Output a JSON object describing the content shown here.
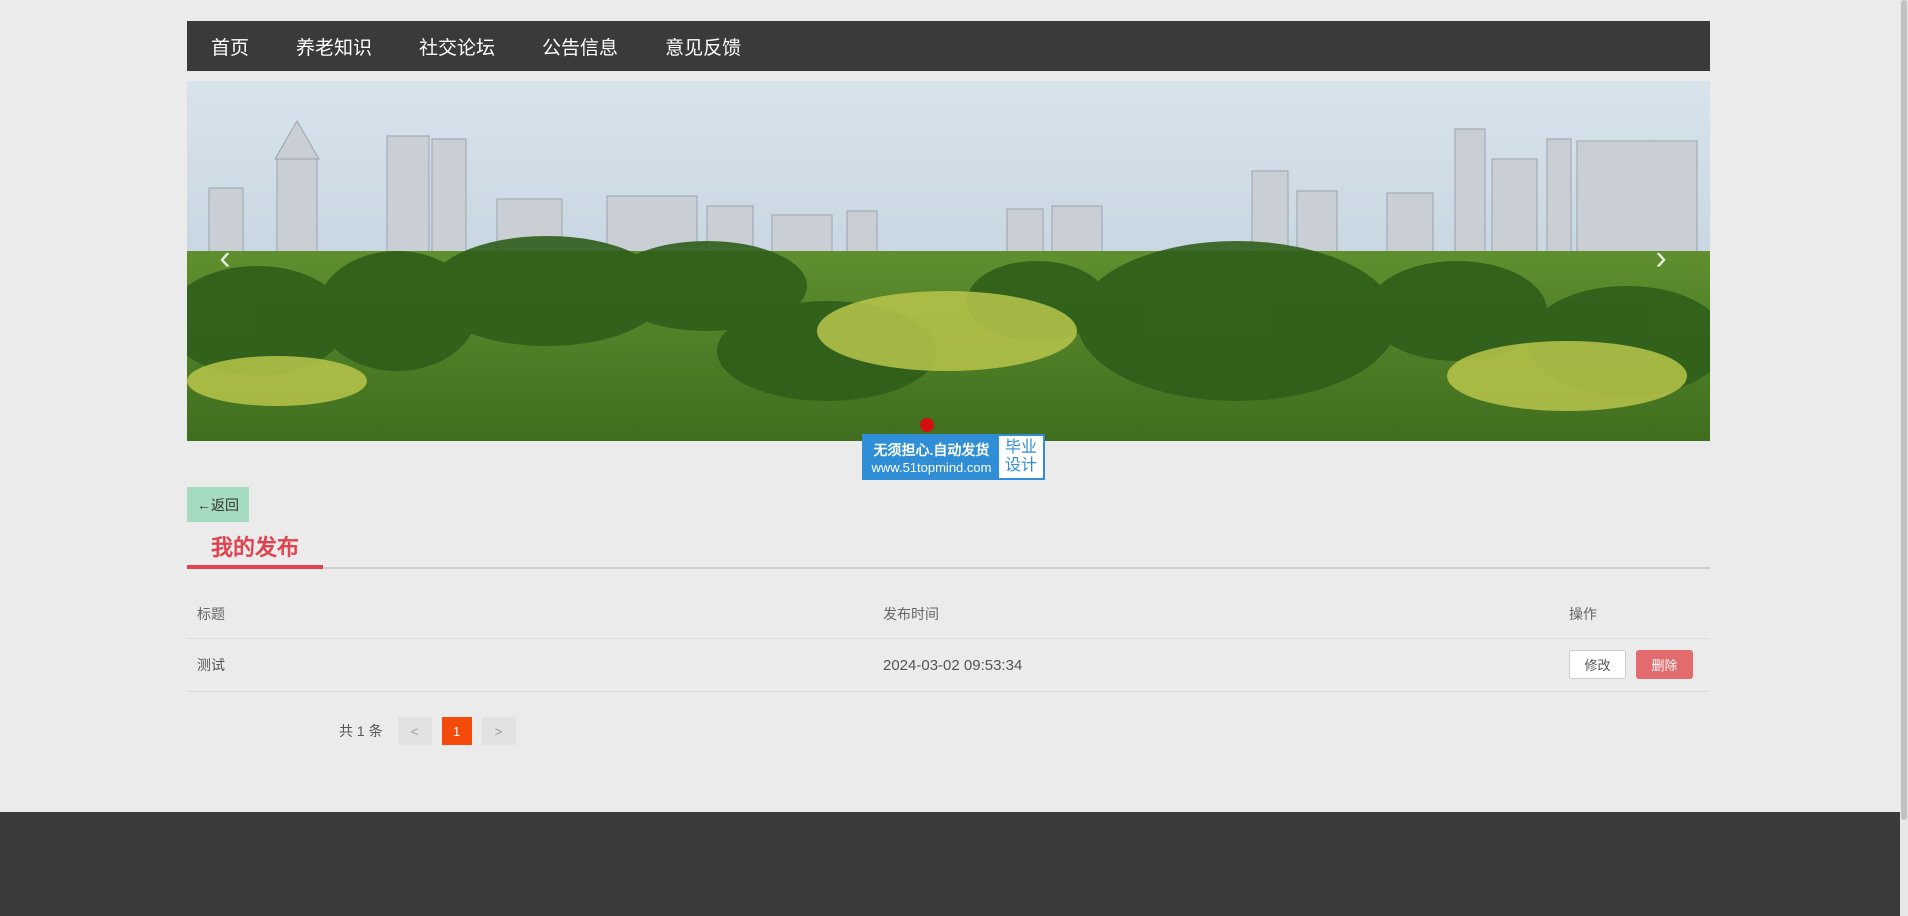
{
  "nav": {
    "items": [
      {
        "label": "首页"
      },
      {
        "label": "养老知识"
      },
      {
        "label": "社交论坛"
      },
      {
        "label": "公告信息"
      },
      {
        "label": "意见反馈"
      }
    ]
  },
  "banner": {
    "prev_icon": "chevron-left-icon",
    "next_icon": "chevron-right-icon",
    "prev_glyph": "‹",
    "next_glyph": "›"
  },
  "watermark": {
    "line1": "无须担心.自动发货",
    "line2": "www.51topmind.com",
    "right_line1": "毕业",
    "right_line2": "设计"
  },
  "back_button": {
    "label": "←返回"
  },
  "section": {
    "title": "我的发布"
  },
  "table": {
    "headers": [
      "标题",
      "发布时间",
      "操作"
    ],
    "rows": [
      {
        "title": "测试",
        "time": "2024-03-02 09:53:34",
        "edit_label": "修改",
        "delete_label": "删除"
      }
    ]
  },
  "pagination": {
    "total": "共 1 条",
    "prev": "<",
    "current": "1",
    "next": ">"
  },
  "colors": {
    "nav_bg": "#3a3a3a",
    "accent_red": "#e0424f",
    "delete_bg": "#e26b6e",
    "page_active": "#f44b0b",
    "back_bg": "#a5dbbe"
  }
}
